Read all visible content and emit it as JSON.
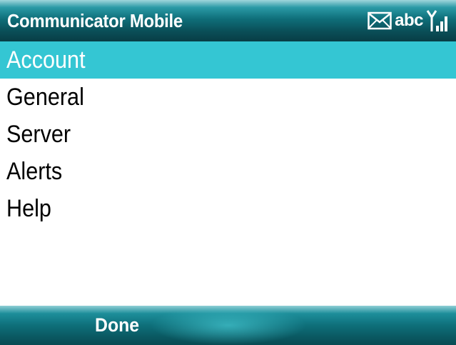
{
  "titlebar": {
    "title": "Communicator Mobile",
    "status": {
      "mail_icon": "envelope-icon",
      "input_mode": "abc",
      "signal_icon": "signal-strength-icon"
    }
  },
  "menu": {
    "items": [
      {
        "label": "Account",
        "selected": true
      },
      {
        "label": "General",
        "selected": false
      },
      {
        "label": "Server",
        "selected": false
      },
      {
        "label": "Alerts",
        "selected": false
      },
      {
        "label": "Help",
        "selected": false
      }
    ]
  },
  "softkeys": {
    "left": "Done"
  },
  "colors": {
    "highlight": "#34c6d3",
    "bar_dark": "#0a4f58",
    "bar_light": "#2a9aa6"
  }
}
